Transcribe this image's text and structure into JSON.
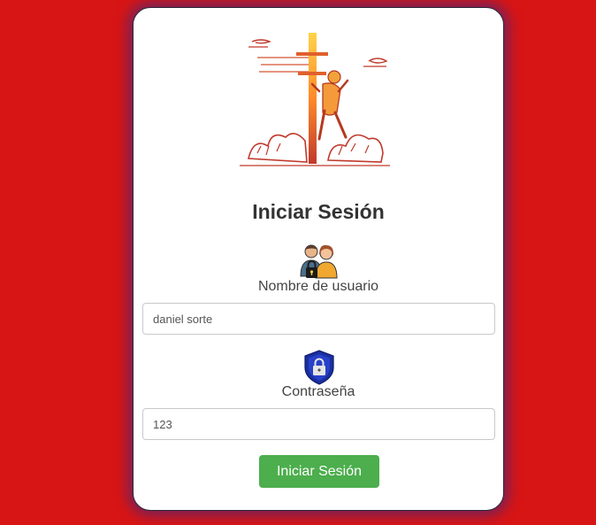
{
  "colors": {
    "background": "#d81515",
    "card": "#ffffff",
    "button": "#4cae4c",
    "title": "#333333"
  },
  "icons": {
    "hero": "lineman-climbing-pole-illustration",
    "username": "users-lock-icon",
    "password": "shield-lock-icon"
  },
  "login": {
    "title": "Iniciar Sesión",
    "username_label": "Nombre de usuario",
    "username_value": "daniel sorte",
    "password_label": "Contraseña",
    "password_value": "123",
    "submit_label": "Iniciar Sesión"
  }
}
